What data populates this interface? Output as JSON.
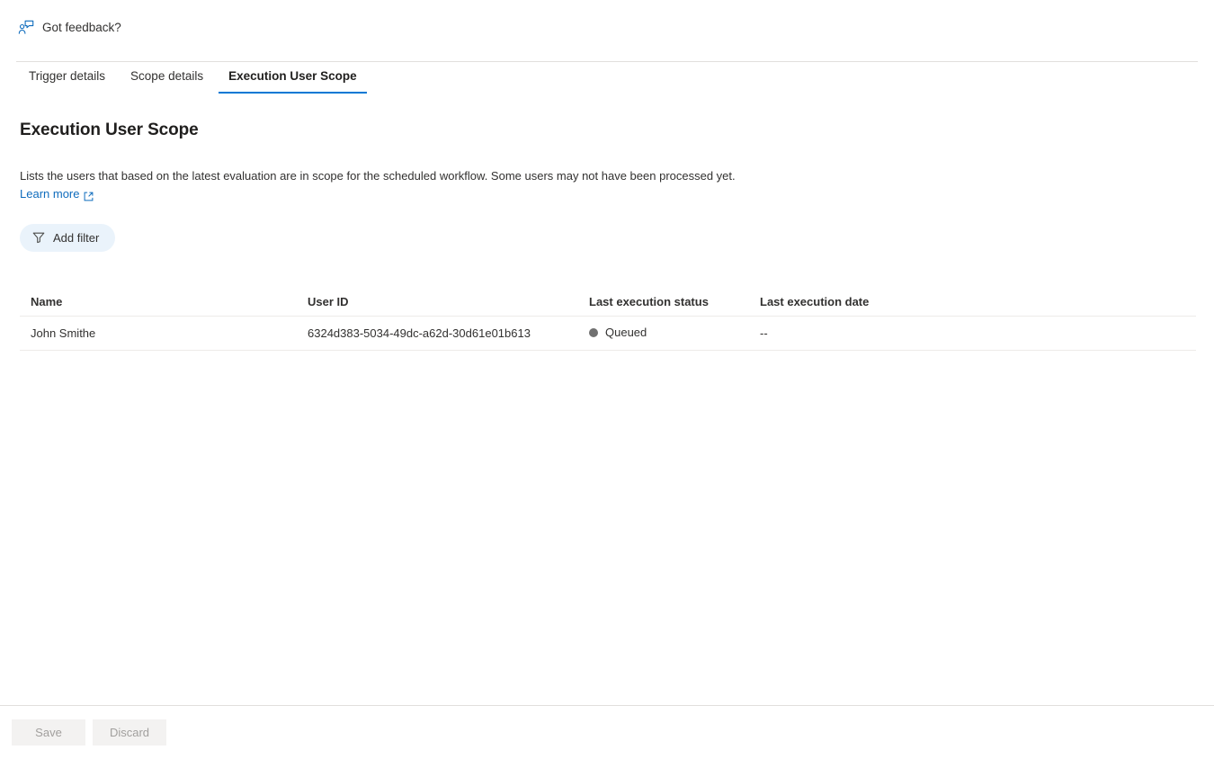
{
  "feedback": {
    "label": "Got feedback?",
    "icon": "person-feedback-icon"
  },
  "tabs": [
    {
      "label": "Trigger details",
      "active": false
    },
    {
      "label": "Scope details",
      "active": false
    },
    {
      "label": "Execution User Scope",
      "active": true
    }
  ],
  "page": {
    "title": "Execution User Scope",
    "description": "Lists the users that based on the latest evaluation are in scope for the scheduled workflow. Some users may not have been processed yet.",
    "learn_more": "Learn more"
  },
  "toolbar": {
    "add_filter_label": "Add filter",
    "filter_icon": "funnel-icon"
  },
  "table": {
    "columns": [
      "Name",
      "User ID",
      "Last execution status",
      "Last execution date"
    ],
    "rows": [
      {
        "name": "John Smithe",
        "user_id": "6324d383-5034-49dc-a62d-30d61e01b613",
        "status": "Queued",
        "status_color": "#707070",
        "date": "--"
      }
    ]
  },
  "footer": {
    "save_label": "Save",
    "discard_label": "Discard"
  },
  "colors": {
    "accent": "#0078d4",
    "link": "#0f6cbd",
    "filter_pill_bg": "#eaf3fb",
    "divider": "#e1dfdd"
  }
}
